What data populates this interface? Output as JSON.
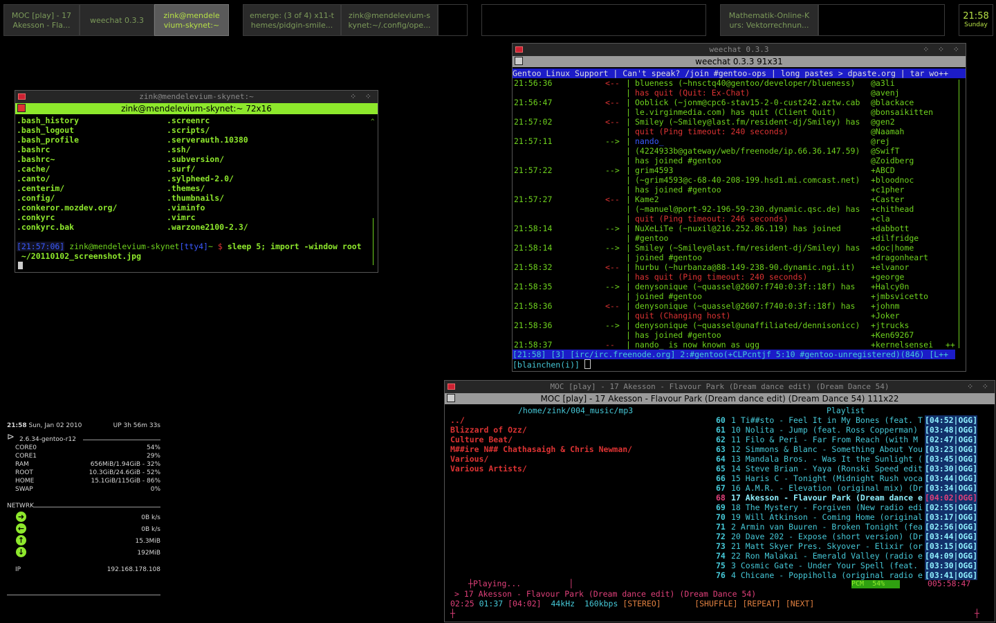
{
  "taskbar": {
    "tasks": [
      {
        "label": "MOC [play] - 17 Akesson - Fla..."
      },
      {
        "label": "weechat 0.3.3"
      },
      {
        "label": "zink@mendele vium-skynet:~"
      },
      {
        "label": "emerge: (3 of 4) x11-t hemes/pidgin-smile..."
      },
      {
        "label": "zink@mendelevium-s kynet:~/.config/ope..."
      },
      {
        "label": "Mathematik-Online-K urs: Vektorrechnun..."
      }
    ],
    "clock_time": "21:58",
    "clock_day": "Sunday"
  },
  "terminal": {
    "title": "zink@mendelevium-skynet:~",
    "subtitle": "zink@mendelevium-skynet:~ 72x16",
    "files_left": [
      ".bash_history",
      ".bash_logout",
      ".bash_profile",
      ".bashrc",
      ".bashrc~",
      ".cache/",
      ".canto/",
      ".centerim/",
      ".config/",
      ".conkeror.mozdev.org/",
      ".conkyrc",
      ".conkyrc.bak"
    ],
    "files_right": [
      ".screenrc",
      ".scripts/",
      ".serverauth.10380",
      ".ssh/",
      ".subversion/",
      ".surf/",
      ".sylpheed-2.0/",
      ".themes/",
      ".thumbnails/",
      ".viminfo",
      ".vimrc",
      ".warzone2100-2.3/"
    ],
    "prompt_time": "[21:57:06]",
    "prompt_host": "zink@mendelevium-skynet",
    "prompt_tty": "[tty4]",
    "prompt_path": "~",
    "prompt_sign": "$",
    "command": "sleep 5; import -window root",
    "command_cont": " ~/20110102_screenshot.jpg"
  },
  "weechat": {
    "title": "weechat 0.3.3",
    "subtitle": "weechat 0.3.3 91x31",
    "topic": "Gentoo Linux Support | Can't speak? /join #gentoo-ops | long pastes > dpaste.org | tar wo++",
    "lines": [
      {
        "time": "21:56:36",
        "arrow": "<--",
        "text": "blueness (~hnsctq40@gentoo/developer/blueness)"
      },
      {
        "time": "",
        "arrow": "",
        "text": "has quit (Quit: Ex-Chat)"
      },
      {
        "time": "21:56:47",
        "arrow": "<--",
        "text": "Ooblick (~jonm@cpc6-stav15-2-0-cust242.aztw.cab"
      },
      {
        "time": "",
        "arrow": "",
        "text": "le.virginmedia.com) has quit (Client Quit)"
      },
      {
        "time": "21:57:02",
        "arrow": "<--",
        "text": "Smiley (~Smiley@last.fm/resident-dj/Smiley) has"
      },
      {
        "time": "",
        "arrow": "",
        "text": "quit (Ping timeout: 240 seconds)"
      },
      {
        "time": "21:57:11",
        "arrow": "-->",
        "text": "nando_"
      },
      {
        "time": "",
        "arrow": "",
        "text": "(4224933b@gateway/web/freenode/ip.66.36.147.59)"
      },
      {
        "time": "",
        "arrow": "",
        "text": "has joined #gentoo"
      },
      {
        "time": "21:57:22",
        "arrow": "-->",
        "text": "grim4593"
      },
      {
        "time": "",
        "arrow": "",
        "text": "(~grim4593@c-68-40-208-199.hsd1.mi.comcast.net)"
      },
      {
        "time": "",
        "arrow": "",
        "text": "has joined #gentoo"
      },
      {
        "time": "21:57:27",
        "arrow": "<--",
        "text": "Kame2"
      },
      {
        "time": "",
        "arrow": "",
        "text": "(~manuel@port-92-196-59-230.dynamic.qsc.de) has"
      },
      {
        "time": "",
        "arrow": "",
        "text": "quit (Ping timeout: 246 seconds)"
      },
      {
        "time": "21:58:14",
        "arrow": "-->",
        "text": "NuXeLiTe (~nuxil@216.252.86.119) has joined"
      },
      {
        "time": "",
        "arrow": "",
        "text": "#gentoo"
      },
      {
        "time": "21:58:14",
        "arrow": "-->",
        "text": "Smiley (~Smiley@last.fm/resident-dj/Smiley) has"
      },
      {
        "time": "",
        "arrow": "",
        "text": "joined #gentoo"
      },
      {
        "time": "21:58:32",
        "arrow": "<--",
        "text": "hurbu (~hurbanza@88-149-238-90.dynamic.ngi.it)"
      },
      {
        "time": "",
        "arrow": "",
        "text": "has quit (Ping timeout: 240 seconds)"
      },
      {
        "time": "21:58:35",
        "arrow": "-->",
        "text": "denysonique (~quassel@2607:f740:0:3f::18f) has"
      },
      {
        "time": "",
        "arrow": "",
        "text": "joined #gentoo"
      },
      {
        "time": "21:58:36",
        "arrow": "<--",
        "text": "denysonique (~quassel@2607:f740:0:3f::18f) has"
      },
      {
        "time": "",
        "arrow": "",
        "text": "quit (Changing host)"
      },
      {
        "time": "21:58:36",
        "arrow": "-->",
        "text": "denysonique (~quassel@unaffiliated/dennisonicc)"
      },
      {
        "time": "",
        "arrow": "",
        "text": "has joined #gentoo"
      },
      {
        "time": "21:58:37",
        "arrow": "--",
        "text": "nando_ is now known as ugg"
      }
    ],
    "nicks": [
      "@a3li",
      "@avenj",
      "@blackace",
      "@bonsaikitten",
      "@gen2",
      "@Naamah",
      "@rej",
      "@SwifT",
      "@Zoidberg",
      "+ABCD",
      "+bloodnoc",
      "+c1pher",
      "+Caster",
      "+chithead",
      "+cla",
      "+dabbott",
      "+dilfridge",
      "+doc|home",
      "+dragonheart",
      "+elvanor",
      "+george",
      "+Halcy0n",
      "+jmbsvicetto",
      "+johnm",
      "+Joker",
      "+jtrucks",
      "+Ken69267",
      "+kernelsensei"
    ],
    "status": "[21:58] [3] [irc/irc.freenode.org] 2:#gentoo(+CLPcntjf 5:10 #gentoo-unregistered)(846) [L++",
    "input": "[blainchen(i)] "
  },
  "moc": {
    "title": "MOC [play] - 17 Akesson - Flavour Park (Dream dance edit) (Dream Dance 54)",
    "subtitle": "MOC [play] - 17 Akesson - Flavour Park (Dream dance edit) (Dream Dance 54) 111x22",
    "dir": "/home/zink/004_music/mp3",
    "playlist_header": "Playlist",
    "dirs": [
      "../",
      "Blizzard of Ozz/",
      "Culture Beat/",
      "M##ire N## Chathasaigh & Chris Newman/",
      "Various/",
      "Various Artists/"
    ],
    "playlist": [
      {
        "n": "60",
        "title": "1 Ti##sto - Feel It in My Bones (feat. T",
        "time": "[04:52|OGG]"
      },
      {
        "n": "61",
        "title": "10 Nolita - Jump (feat. Ross Copperman)",
        "time": "[03:48|OGG]"
      },
      {
        "n": "62",
        "title": "11 Filo & Peri - Far From Reach (with M",
        "time": "[02:47|OGG]"
      },
      {
        "n": "63",
        "title": "12 Simmons & Blanc - Something About You",
        "time": "[03:23|OGG]"
      },
      {
        "n": "64",
        "title": "13 Mandala Bros. - Was It the Sunlight (",
        "time": "[03:45|OGG]"
      },
      {
        "n": "65",
        "title": "14 Steve Brian - Yaya (Ronski Speed edit",
        "time": "[03:30|OGG]"
      },
      {
        "n": "66",
        "title": "15 Haris C - Tonight (Midnight Rush voca",
        "time": "[03:44|OGG]"
      },
      {
        "n": "67",
        "title": "16 A.M.R. - Elevation (original mix) (Dr",
        "time": "[03:34|OGG]"
      },
      {
        "n": "68",
        "title": "17 Akesson - Flavour Park (Dream dance e",
        "time": "[04:02|OGG]"
      },
      {
        "n": "69",
        "title": "18 The Mystery - Forgiven (New radio edi",
        "time": "[02:55|OGG]"
      },
      {
        "n": "70",
        "title": "19 Will Atkinson - Coming Home (original",
        "time": "[03:17|OGG]"
      },
      {
        "n": "71",
        "title": "2 Armin van Buuren - Broken Tonight (fea",
        "time": "[02:56|OGG]"
      },
      {
        "n": "72",
        "title": "20 Dave 202 - Expose (short version) (Dr",
        "time": "[03:44|OGG]"
      },
      {
        "n": "73",
        "title": "21 Matt Skyer Pres. Skyover - Elixir (or",
        "time": "[03:15|OGG]"
      },
      {
        "n": "74",
        "title": "22 Ron Malakai - Emerald Valley (radio e",
        "time": "[04:09|OGG]"
      },
      {
        "n": "75",
        "title": "3 Cosmic Gate - Under Your Spell (feat.",
        "time": "[03:30|OGG]"
      },
      {
        "n": "76",
        "title": "4 Chicane - Poppiholla (original radio e",
        "time": "[03:41|OGG]"
      }
    ],
    "state": "Playing...",
    "pcm": "PCM  54%",
    "total": "005:58:47",
    "now": "> 17 Akesson - Flavour Park (Dream dance edit) (Dream Dance 54)",
    "elapsed": "02:25",
    "remaining": "01:37",
    "length": "[04:02]",
    "rate": "44kHz",
    "bitrate": "160kbps",
    "stereo": "[STEREO]",
    "shuffle": "[SHUFFLE]",
    "repeat": "[REPEAT]",
    "next": "[NEXT]"
  },
  "conky": {
    "time": "21:58",
    "date": "Sun, Jan 02 2010",
    "uptime": "UP 3h 56m 33s",
    "kernel": "2.6.34-gentoo-r12",
    "rows": [
      {
        "k": "CORE0",
        "v": "54%"
      },
      {
        "k": "CORE1",
        "v": "29%"
      },
      {
        "k": "RAM",
        "v": "656MiB/1.94GiB - 32%"
      },
      {
        "k": "ROOT",
        "v": "10.3GiB/24.6GiB - 52%"
      },
      {
        "k": "HOME",
        "v": "15.1GiB/115GiB - 86%"
      },
      {
        "k": "SWAP",
        "v": "0%"
      }
    ],
    "net_label": "NETWRK",
    "net": [
      {
        "v": "0B  k/s"
      },
      {
        "v": "0B  k/s"
      },
      {
        "v": "15.3MiB"
      },
      {
        "v": "192MiB"
      }
    ],
    "ip_label": "IP",
    "ip": "192.168.178.108"
  }
}
